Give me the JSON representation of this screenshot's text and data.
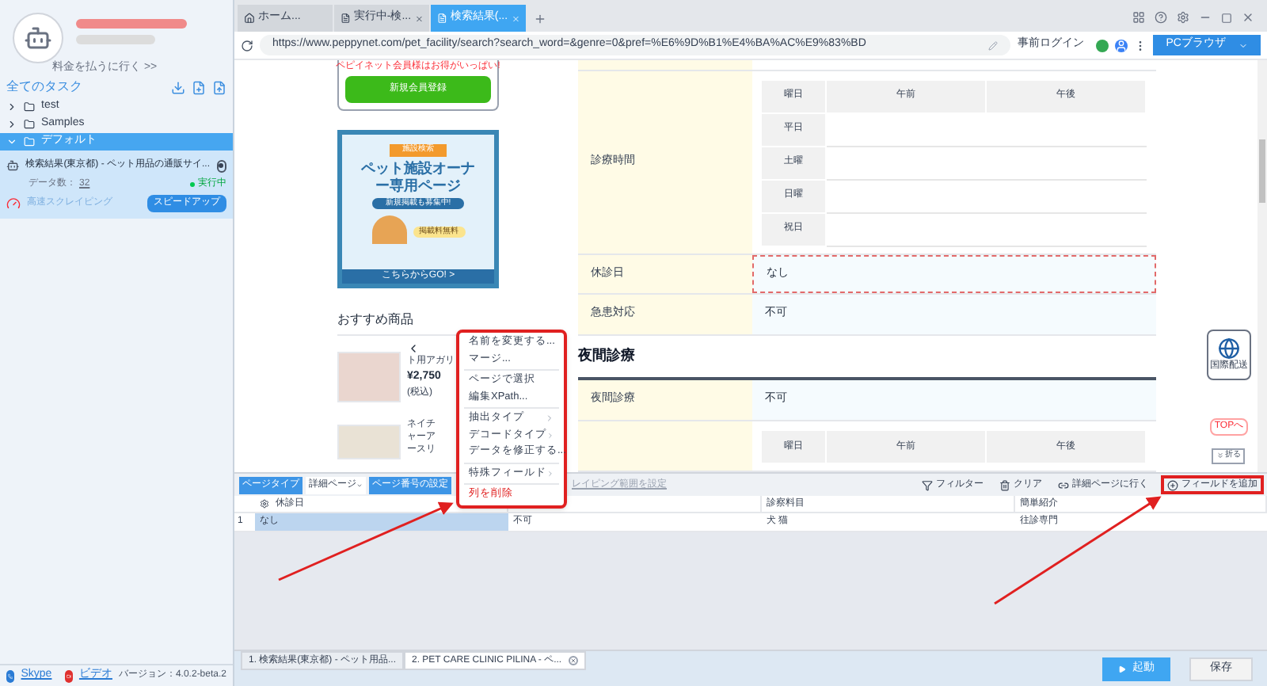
{
  "sidebar": {
    "pay_link": "料金を払うに行く >>",
    "all_tasks": "全てのタスク",
    "folders": [
      {
        "label": "test",
        "expanded": false,
        "selected": false
      },
      {
        "label": "Samples",
        "expanded": false,
        "selected": false
      },
      {
        "label": "デフォルト",
        "expanded": true,
        "selected": true,
        "tasks": [
          {
            "title": "検索結果(東京都) - ペット用品の通販サイ...",
            "count_label": "データ数：",
            "count": "32",
            "status": "実行中",
            "mode": "高速スクレイピング",
            "action": "スピードアップ"
          }
        ]
      }
    ],
    "links": [
      "Skype",
      "ビデオ"
    ],
    "version": "バージョン：4.0.2-beta.2"
  },
  "browser": {
    "tabs": [
      {
        "label": "ホーム...",
        "kind": "home",
        "selected": false
      },
      {
        "label": "実行中-検...",
        "kind": "page",
        "selected": false
      },
      {
        "label": "検索結果(...",
        "kind": "page",
        "selected": true
      }
    ],
    "url": "https://www.peppynet.com/pet_facility/search?search_word=&genre=0&pref=%E6%9D%B1%E4%BA%AC%E9%83%BD",
    "login": "事前ログイン",
    "mode": "PCブラウザ"
  },
  "page": {
    "notice": "ペピイネット会員様はお得がいっぱい!",
    "register": "新規会員登録",
    "banner": {
      "tag": "施設検索",
      "title": "ペット施設オーナー専用ページ",
      "sub": "新規掲載も募集中!",
      "free": "掲載料無料",
      "go": "こちらからGO! >"
    },
    "recommend": "おすすめ商品",
    "products": [
      {
        "name": "ト用アガリ",
        "price": "¥2,750",
        "tax": "(税込)"
      },
      {
        "name": "ネイチャーアースリ"
      }
    ],
    "rows": [
      {
        "kind": "schedule",
        "label": "診療時間",
        "header": [
          "曜日",
          "午前",
          "午後"
        ],
        "days": [
          "平日",
          "土曜",
          "日曜",
          "祝日"
        ]
      },
      {
        "kind": "field",
        "label": "休診日",
        "value": "なし",
        "selected": true
      },
      {
        "kind": "field",
        "label": "急患対応",
        "value": "不可",
        "selected": false
      },
      {
        "kind": "heading",
        "label": "夜間診療"
      },
      {
        "kind": "field",
        "label": "夜間診療",
        "value": "不可",
        "selected": false
      },
      {
        "kind": "schedule",
        "header": [
          "曜日",
          "午前",
          "午後"
        ],
        "days": []
      }
    ],
    "shipping": "国際配送",
    "top": "TOPへ",
    "fold": "折る"
  },
  "context_menu": [
    {
      "label": "名前を変更する...",
      "kind": "item"
    },
    {
      "label": "マージ...",
      "kind": "item"
    },
    {
      "kind": "divider"
    },
    {
      "label": "ページで選択",
      "kind": "item"
    },
    {
      "label": "編集XPath...",
      "kind": "item"
    },
    {
      "kind": "divider"
    },
    {
      "label": "抽出タイプ",
      "kind": "submenu"
    },
    {
      "label": "デコードタイプ",
      "kind": "submenu"
    },
    {
      "label": "データを修正する...",
      "kind": "item"
    },
    {
      "kind": "divider"
    },
    {
      "label": "特殊フィールド",
      "kind": "submenu"
    },
    {
      "kind": "divider"
    },
    {
      "label": "列を削除",
      "kind": "danger"
    }
  ],
  "panel": {
    "page_type_label": "ページタイプ",
    "page_type": "詳細ページ",
    "page_number": "ページ番号の設定",
    "range": "レイピング範囲を設定",
    "tools": [
      {
        "label": "フィルター",
        "kind": "filter",
        "highlighted": false
      },
      {
        "label": "クリア",
        "kind": "clear",
        "highlighted": false
      },
      {
        "label": "詳細ページに行く",
        "kind": "link",
        "highlighted": false
      },
      {
        "label": "フィールドを追加",
        "kind": "add",
        "highlighted": true
      }
    ],
    "columns": [
      {
        "label": "休診日"
      },
      {},
      {
        "label": "診察料目"
      },
      {
        "label": "簡単紹介"
      }
    ],
    "rows": [
      {
        "number": "1",
        "cells": [
          {
            "text": "なし",
            "selected": true
          },
          {
            "text": "不可",
            "selected": false
          },
          {
            "text": "犬 猫",
            "selected": false
          },
          {
            "text": "往診専門",
            "selected": false
          }
        ]
      }
    ]
  },
  "task_tabs": [
    {
      "label": "1. 検索結果(東京都) - ペット用品...",
      "selected": false
    },
    {
      "label": "2. PET CARE CLINIC PILINA - ペ...",
      "selected": true
    }
  ],
  "actions": {
    "start": "起動",
    "save": "保存"
  }
}
